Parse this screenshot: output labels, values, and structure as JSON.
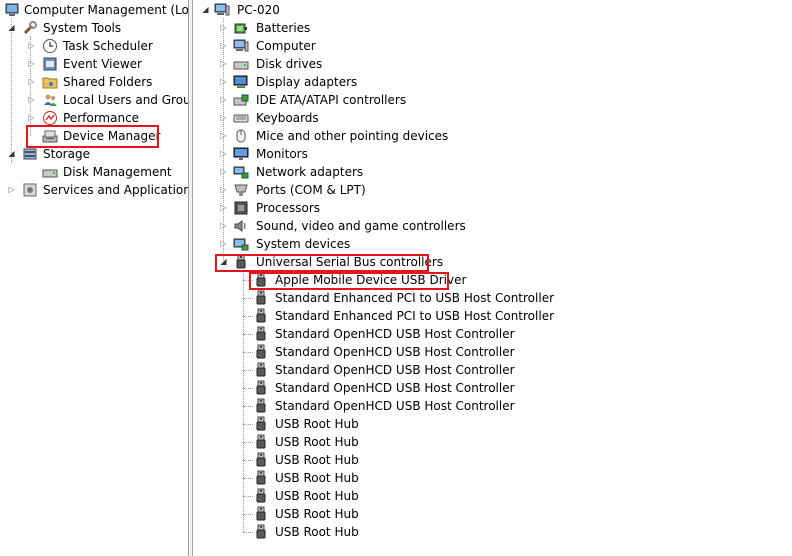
{
  "left_tree": {
    "root": {
      "label": "Computer Management (Local"
    },
    "system_tools": {
      "label": "System Tools"
    },
    "task_scheduler": {
      "label": "Task Scheduler"
    },
    "event_viewer": {
      "label": "Event Viewer"
    },
    "shared_folders": {
      "label": "Shared Folders"
    },
    "local_users": {
      "label": "Local Users and Groups"
    },
    "performance": {
      "label": "Performance"
    },
    "device_manager": {
      "label": "Device Manager"
    },
    "storage": {
      "label": "Storage"
    },
    "disk_management": {
      "label": "Disk Management"
    },
    "services": {
      "label": "Services and Applications"
    }
  },
  "device_tree": {
    "root": {
      "label": "PC-020"
    },
    "categories": [
      {
        "label": "Batteries",
        "icon": "battery-icon"
      },
      {
        "label": "Computer",
        "icon": "computer-icon"
      },
      {
        "label": "Disk drives",
        "icon": "disk-drive-icon"
      },
      {
        "label": "Display adapters",
        "icon": "display-adapter-icon"
      },
      {
        "label": "IDE ATA/ATAPI controllers",
        "icon": "ide-controller-icon"
      },
      {
        "label": "Keyboards",
        "icon": "keyboard-icon"
      },
      {
        "label": "Mice and other pointing devices",
        "icon": "mouse-icon"
      },
      {
        "label": "Monitors",
        "icon": "monitor-icon"
      },
      {
        "label": "Network adapters",
        "icon": "network-adapter-icon"
      },
      {
        "label": "Ports (COM & LPT)",
        "icon": "port-icon"
      },
      {
        "label": "Processors",
        "icon": "processor-icon"
      },
      {
        "label": "Sound, video and game controllers",
        "icon": "speaker-icon"
      },
      {
        "label": "System devices",
        "icon": "system-device-icon"
      }
    ],
    "usb": {
      "label": "Universal Serial Bus controllers",
      "children": [
        "Apple Mobile Device USB Driver",
        "Standard Enhanced PCI to USB Host Controller",
        "Standard Enhanced PCI to USB Host Controller",
        "Standard OpenHCD USB Host Controller",
        "Standard OpenHCD USB Host Controller",
        "Standard OpenHCD USB Host Controller",
        "Standard OpenHCD USB Host Controller",
        "Standard OpenHCD USB Host Controller",
        "USB Root Hub",
        "USB Root Hub",
        "USB Root Hub",
        "USB Root Hub",
        "USB Root Hub",
        "USB Root Hub",
        "USB Root Hub"
      ]
    }
  },
  "colors": {
    "highlight": "#e4161c",
    "splitter": "#f0f0f0"
  }
}
